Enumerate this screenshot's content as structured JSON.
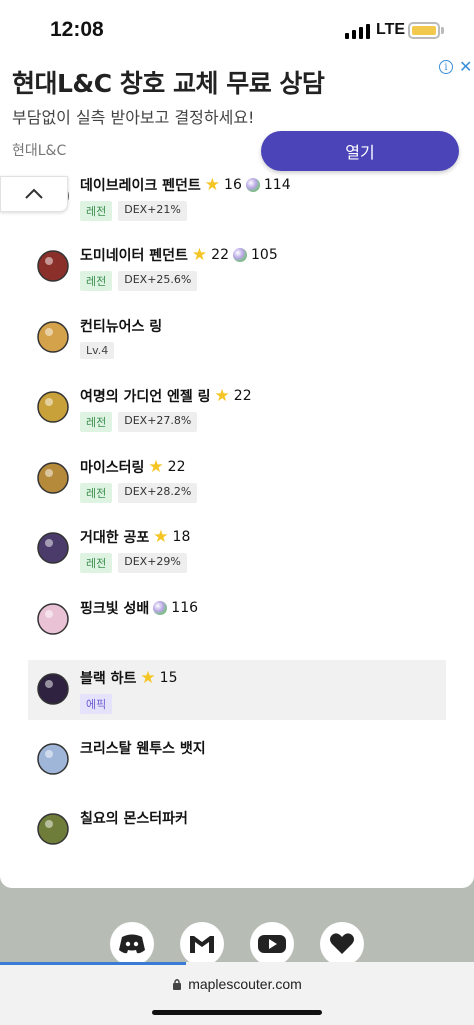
{
  "status": {
    "time": "12:08",
    "network": "LTE"
  },
  "ad": {
    "title": "현대L&C 창호 교체 무료 상담",
    "subtitle": "부담없이 실측 받아보고 결정하세요!",
    "brand": "현대L&C",
    "open_label": "열기",
    "close_glyph": "✕",
    "info_glyph": "i"
  },
  "items": [
    {
      "name": "데이브레이크 펜던트",
      "stars": "16",
      "potion": "114",
      "tags": [
        {
          "label": "레전",
          "kind": "legend"
        },
        {
          "label": "DEX+21%",
          "kind": "stat"
        }
      ]
    },
    {
      "name": "도미네이터 펜던트",
      "stars": "22",
      "potion": "105",
      "tags": [
        {
          "label": "레전",
          "kind": "legend"
        },
        {
          "label": "DEX+25.6%",
          "kind": "stat"
        }
      ]
    },
    {
      "name": "컨티뉴어스 링",
      "stars": "",
      "potion": "",
      "tags": [
        {
          "label": "Lv.4",
          "kind": "lv"
        }
      ]
    },
    {
      "name": "여명의 가디언 엔젤 링",
      "stars": "22",
      "potion": "",
      "tags": [
        {
          "label": "레전",
          "kind": "legend"
        },
        {
          "label": "DEX+27.8%",
          "kind": "stat"
        }
      ]
    },
    {
      "name": "마이스터링",
      "stars": "22",
      "potion": "",
      "tags": [
        {
          "label": "레전",
          "kind": "legend"
        },
        {
          "label": "DEX+28.2%",
          "kind": "stat"
        }
      ]
    },
    {
      "name": "거대한 공포",
      "stars": "18",
      "potion": "",
      "tags": [
        {
          "label": "레전",
          "kind": "legend"
        },
        {
          "label": "DEX+29%",
          "kind": "stat"
        }
      ]
    },
    {
      "name": "핑크빛 성배",
      "stars": "",
      "potion": "116",
      "tags": []
    },
    {
      "name": "블랙 하트",
      "stars": "15",
      "potion": "",
      "tags": [
        {
          "label": "에픽",
          "kind": "epic"
        }
      ]
    },
    {
      "name": "크리스탈 웬투스 뱃지",
      "stars": "",
      "potion": "",
      "tags": []
    },
    {
      "name": "칠요의 몬스터파커",
      "stars": "",
      "potion": "",
      "tags": []
    }
  ],
  "footer": {
    "icons": [
      "discord-icon",
      "gmail-icon",
      "youtube-icon",
      "heart-icon"
    ],
    "url": "maplescouter.com"
  },
  "colors": {
    "accent": "#4a44b8",
    "legend": "#3a8e4d",
    "epic": "#6a5fcf",
    "star": "#f5c623"
  }
}
